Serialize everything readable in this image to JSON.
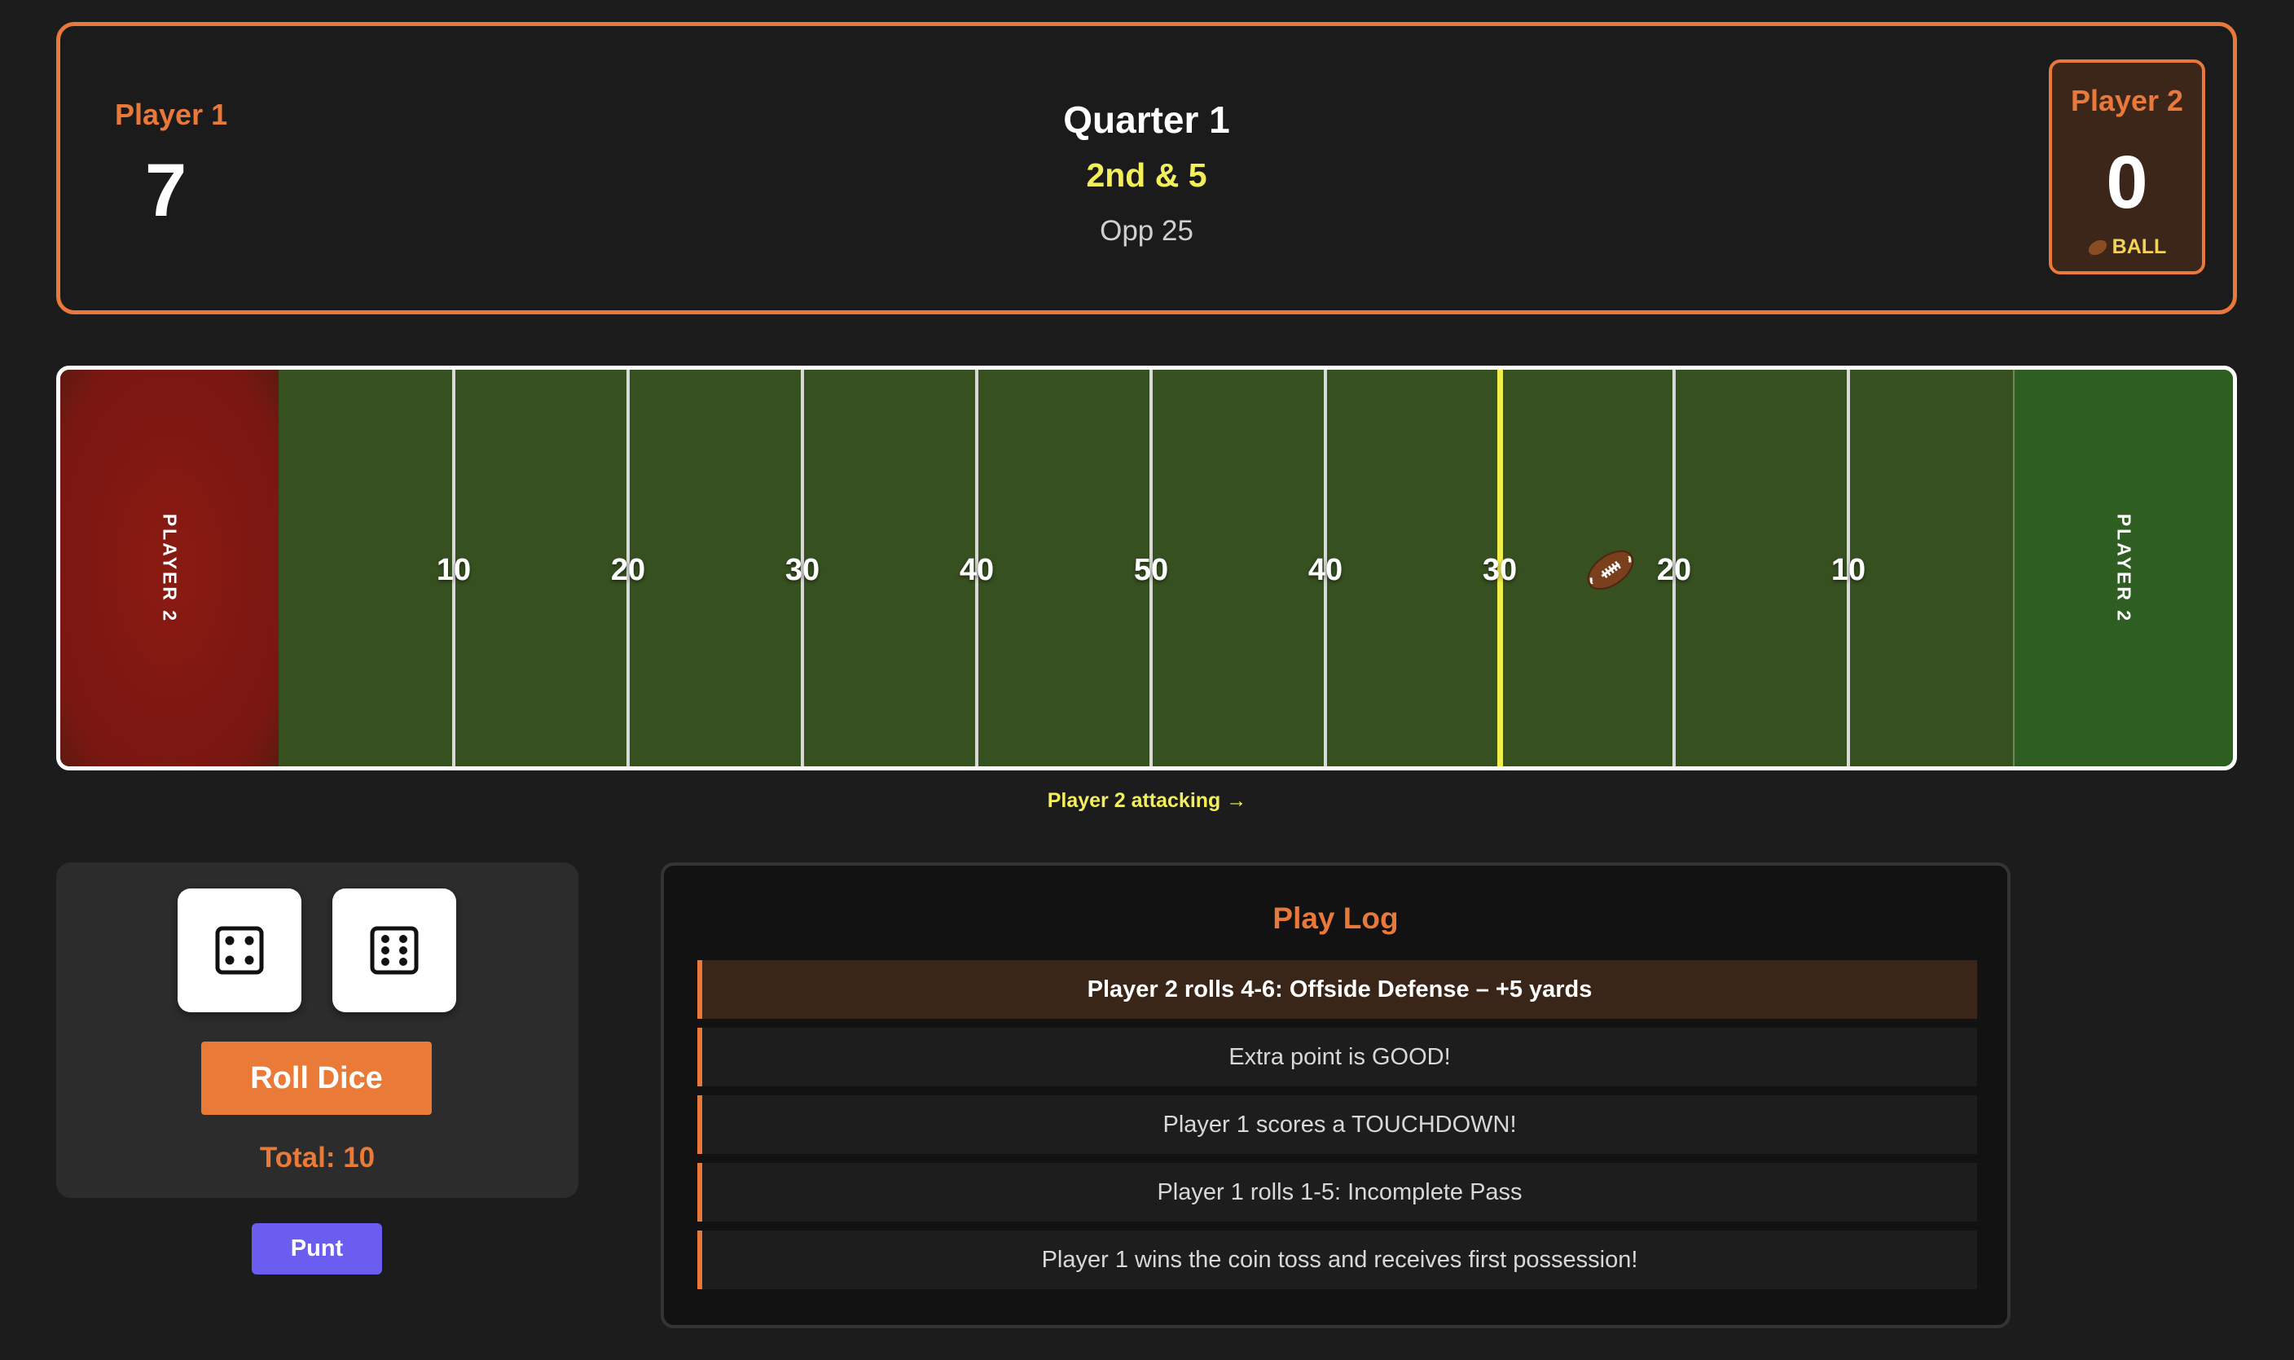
{
  "scoreboard": {
    "player1": {
      "name": "Player 1",
      "score": "7"
    },
    "player2": {
      "name": "Player 2",
      "score": "0",
      "possession_label": "BALL",
      "possession_icon": "football-icon"
    },
    "quarter": "Quarter 1",
    "down_distance": "2nd & 5",
    "ball_spot": "Opp 25"
  },
  "field": {
    "left_endzone_label": "PLAYER 2",
    "right_endzone_label": "PLAYER 2",
    "yard_numbers": [
      "10",
      "20",
      "30",
      "40",
      "50",
      "40",
      "30",
      "20",
      "10"
    ],
    "left_endzone_color": "#7a1712",
    "right_endzone_color": "#2f5e22",
    "field_color": "#365020",
    "scrimmage_color": "#f0ee4c",
    "ball_icon": "football-icon"
  },
  "attacking_label": "Player 2 attacking →",
  "dice": {
    "die1": 4,
    "die2": 6,
    "roll_label": "Roll Dice",
    "total_label": "Total: 10"
  },
  "punt_label": "Punt",
  "play_log": {
    "title": "Play Log",
    "entries": [
      "Player 2 rolls 4-6: Offside Defense – +5 yards",
      "Extra point is GOOD!",
      "Player 1 scores a TOUCHDOWN!",
      "Player 1 rolls 1-5: Incomplete Pass",
      "Player 1 wins the coin toss and receives first possession!"
    ]
  },
  "colors": {
    "accent": "#e8793a",
    "highlight": "#f3ef5a",
    "punt": "#6a5df0"
  }
}
